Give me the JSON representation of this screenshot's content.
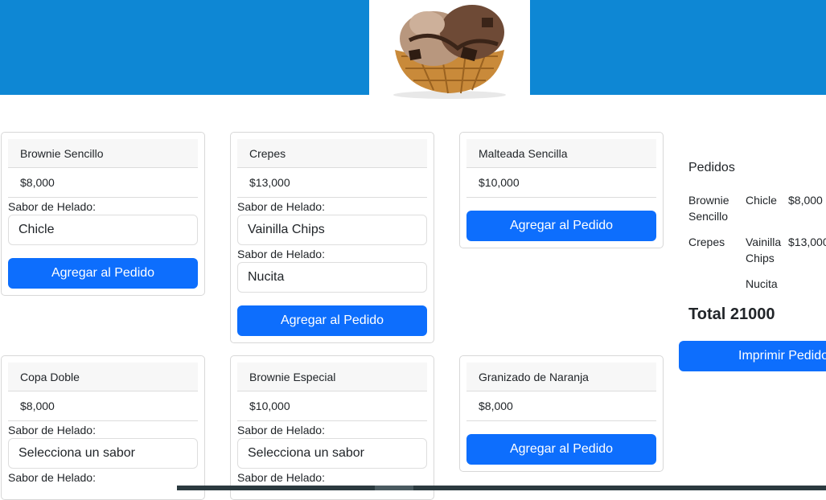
{
  "header": {
    "image_icon": "ice-cream-waffle-bowl-image"
  },
  "products": [
    {
      "name": "Brownie Sencillo",
      "price": "$8,000",
      "flavor_label": "Sabor de Helado:",
      "selects": [
        "Chicle"
      ],
      "button": "Agregar al Pedido"
    },
    {
      "name": "Crepes",
      "price": "$13,000",
      "flavor_label": "Sabor de Helado:",
      "selects": [
        "Vainilla Chips",
        "Nucita"
      ],
      "button": "Agregar al Pedido"
    },
    {
      "name": "Malteada Sencilla",
      "price": "$10,000",
      "button": "Agregar al Pedido"
    },
    {
      "name": "Copa Doble",
      "price": "$8,000",
      "flavor_label": "Sabor de Helado:",
      "selects": [
        "Selecciona un sabor"
      ],
      "flavor_label_2": "Sabor de Helado:"
    },
    {
      "name": "Brownie Especial",
      "price": "$10,000",
      "flavor_label": "Sabor de Helado:",
      "selects": [
        "Selecciona un sabor"
      ],
      "flavor_label_2": "Sabor de Helado:"
    },
    {
      "name": "Granizado de Naranja",
      "price": "$8,000",
      "button": "Agregar al Pedido"
    }
  ],
  "orders": {
    "title": "Pedidos",
    "items": [
      {
        "name": "Brownie Sencillo",
        "flavor": "Chicle",
        "price": "$8,000"
      },
      {
        "name": "Crepes",
        "flavor": "Vainilla Chips",
        "price": "$13,000"
      },
      {
        "name": "",
        "flavor": "Nucita",
        "price": ""
      }
    ],
    "total": "Total 21000",
    "print_button": "Imprimir Pedido"
  }
}
